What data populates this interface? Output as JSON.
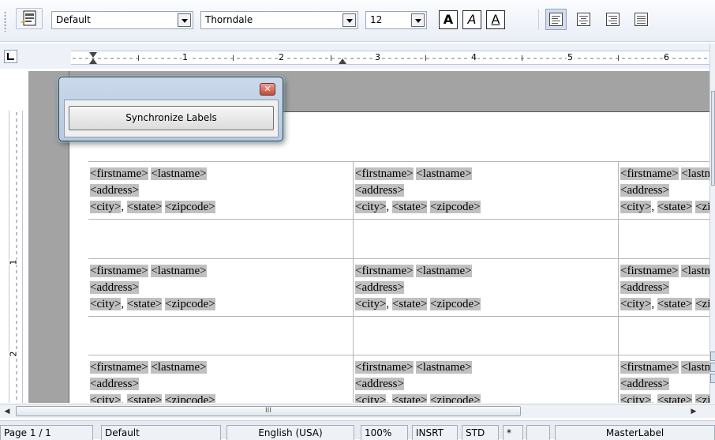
{
  "toolbar": {
    "paragraph_style": "Default",
    "font_name": "Thorndale",
    "font_size": "12",
    "bold_glyph": "A",
    "italic_glyph": "A",
    "underline_glyph": "A"
  },
  "ruler": {
    "horizontal_numbers": [
      "1",
      "2",
      "3",
      "4",
      "5",
      "6"
    ],
    "vertical_numbers": [
      "1",
      "2"
    ]
  },
  "dialog": {
    "close_glyph": "✕",
    "button_label": "Synchronize Labels"
  },
  "labels": {
    "line1": {
      "first": "<firstname>",
      "last": "<lastname>"
    },
    "line2": {
      "address": "<address>"
    },
    "line3": {
      "city": "<city>",
      "comma": ",",
      "state": "<state>",
      "zip": "<zipcode>"
    }
  },
  "hscroll": {
    "thumb_grip": "III"
  },
  "statusbar": {
    "page": "Page 1 / 1",
    "page_style": "Default",
    "language": "English (USA)",
    "zoom": "100%",
    "insert_mode": "INSRT",
    "selection_mode": "STD",
    "modified": "*",
    "signature": "",
    "section": "MasterLabel"
  }
}
